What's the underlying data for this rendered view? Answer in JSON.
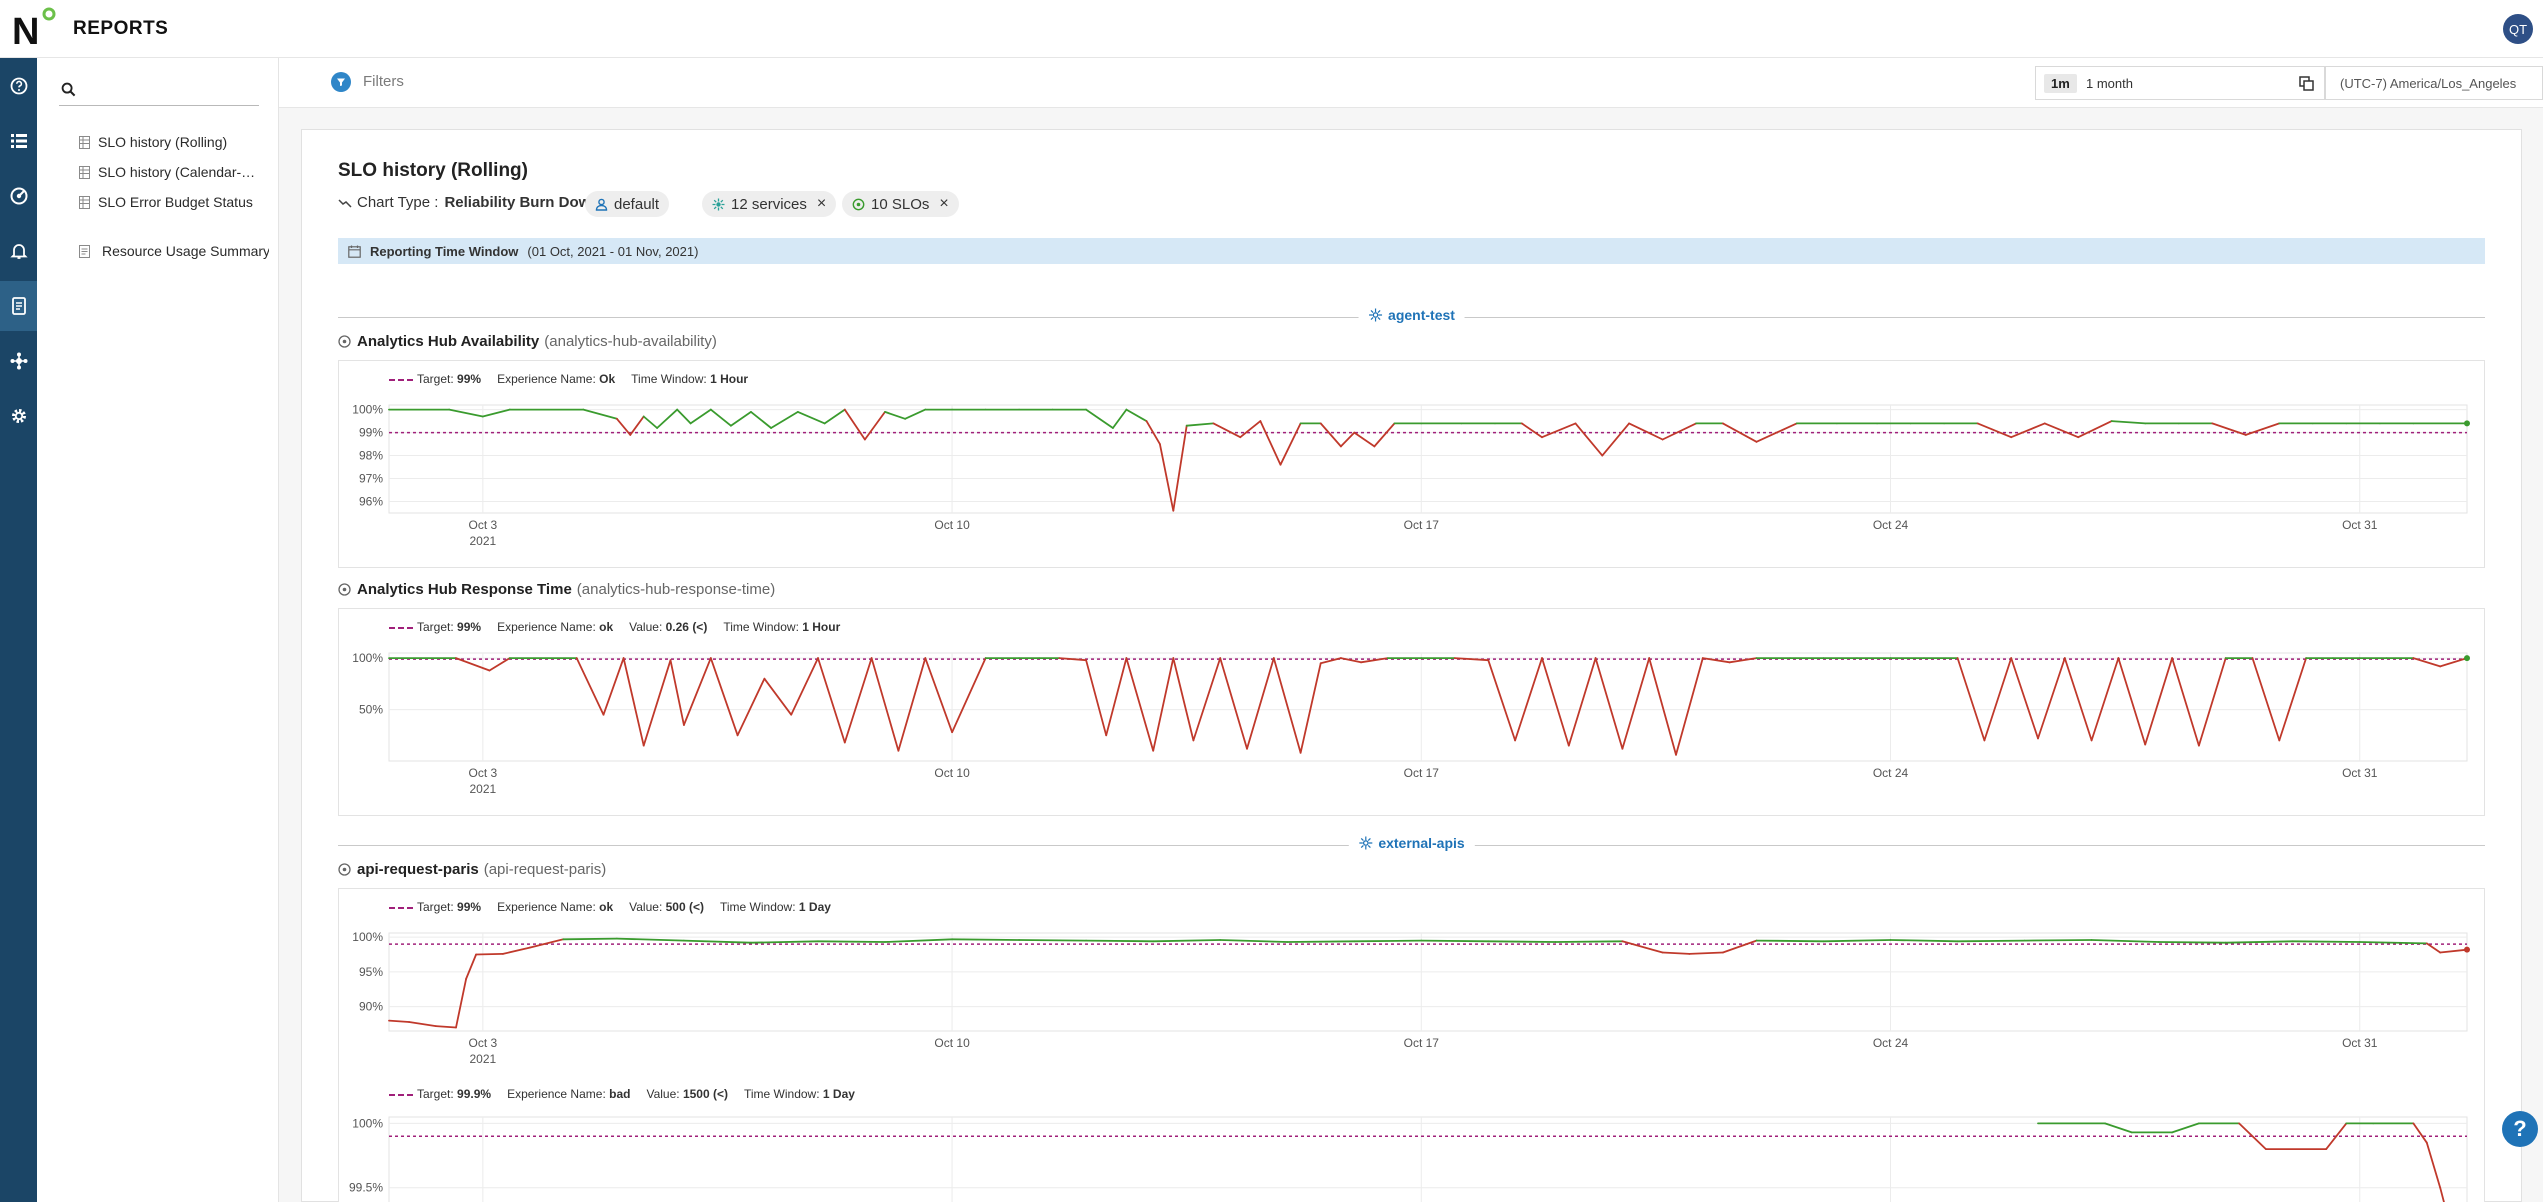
{
  "app": {
    "title": "REPORTS",
    "avatar": "QT",
    "logo_letter": "N"
  },
  "rail": {
    "icons": [
      "help-circle-icon",
      "list-icon",
      "gauge-icon",
      "bell-icon",
      "report-icon",
      "integrations-icon",
      "settings-icon"
    ],
    "active_index": 4
  },
  "sidebar": {
    "items": [
      {
        "label": "SLO history (Rolling)",
        "icon": "table-icon"
      },
      {
        "label": "SLO history (Calendar-Aligned)",
        "icon": "table-icon"
      },
      {
        "label": "SLO Error Budget Status",
        "icon": "table-icon"
      },
      {
        "label": "Resource Usage Summary",
        "icon": "document-icon"
      }
    ]
  },
  "filterbar": {
    "filters_label": "Filters",
    "range_chip": "1m",
    "range_text": "1 month",
    "timezone": "(UTC-7) America/Los_Angeles"
  },
  "report": {
    "title": "SLO history (Rolling)",
    "chart_type_label": "Chart Type :",
    "chart_type_value": "Reliability Burn Down",
    "pills": {
      "project": "default",
      "services": "12 services",
      "slos": "10 SLOs"
    },
    "window_label": "Reporting Time Window",
    "window_range": "(01 Oct, 2021 - 01 Nov, 2021)"
  },
  "sections": [
    {
      "service": "agent-test"
    },
    {
      "service": "external-apis"
    }
  ],
  "slos": [
    {
      "name": "Analytics Hub Availability",
      "slug": "(analytics-hub-availability)"
    },
    {
      "name": "Analytics Hub Response Time",
      "slug": "(analytics-hub-response-time)"
    },
    {
      "name": "api-request-paris",
      "slug": "(api-request-paris)"
    }
  ],
  "legend_labels": {
    "target": "Target:",
    "experience": "Experience Name:",
    "value": "Value:",
    "window": "Time Window:"
  },
  "colors": {
    "good": "#3a9b2e",
    "bad": "#c0392b",
    "target": "#a0207a",
    "accent": "#1f73b7",
    "rail": "#1b4566"
  },
  "chart_data": [
    {
      "type": "line",
      "slo": "Analytics Hub Availability",
      "target": "99%",
      "target_value": 99,
      "experience": "Ok",
      "value": "",
      "time_window": "1 Hour",
      "ylim": [
        95.5,
        100.2
      ],
      "yticks": [
        {
          "v": 100,
          "label": "100%"
        },
        {
          "v": 99,
          "label": "99%"
        },
        {
          "v": 98,
          "label": "98%"
        },
        {
          "v": 97,
          "label": "97%"
        },
        {
          "v": 96,
          "label": "96%"
        }
      ],
      "xticks": [
        {
          "day": 3,
          "label": "Oct 3",
          "sub": "2021"
        },
        {
          "day": 10,
          "label": "Oct 10",
          "sub": ""
        },
        {
          "day": 17,
          "label": "Oct 17",
          "sub": ""
        },
        {
          "day": 24,
          "label": "Oct 24",
          "sub": ""
        },
        {
          "day": 31,
          "label": "Oct 31",
          "sub": ""
        }
      ],
      "xlim": [
        1.6,
        32.6
      ],
      "x": [
        1.6,
        2.5,
        3.0,
        3.4,
        4.5,
        5.0,
        5.2,
        5.4,
        5.6,
        5.9,
        6.1,
        6.4,
        6.7,
        7.0,
        7.3,
        7.7,
        8.1,
        8.4,
        8.7,
        9.0,
        9.3,
        9.6,
        10.0,
        10.5,
        11.0,
        11.5,
        12.0,
        12.4,
        12.6,
        12.9,
        13.1,
        13.3,
        13.5,
        13.9,
        14.3,
        14.6,
        14.9,
        15.2,
        15.5,
        15.8,
        16.0,
        16.3,
        16.6,
        17.0,
        17.6,
        18.1,
        18.5,
        18.8,
        19.3,
        19.7,
        20.1,
        20.6,
        21.1,
        21.5,
        22.0,
        22.6,
        23.2,
        23.8,
        24.3,
        24.8,
        25.3,
        25.8,
        26.3,
        26.8,
        27.3,
        27.8,
        28.3,
        28.8,
        29.3,
        29.8,
        30.3,
        30.8,
        31.3,
        31.8,
        32.6
      ],
      "y": [
        100,
        100,
        99.7,
        100,
        100,
        99.6,
        98.9,
        99.7,
        99.2,
        100,
        99.4,
        100,
        99.3,
        99.9,
        99.2,
        99.9,
        99.4,
        100,
        98.7,
        99.9,
        99.6,
        100,
        100,
        100,
        100,
        100,
        100,
        99.2,
        100,
        99.5,
        98.5,
        95.6,
        99.3,
        99.4,
        98.8,
        99.5,
        97.6,
        99.4,
        99.4,
        98.4,
        99.0,
        98.4,
        99.4,
        99.4,
        99.4,
        99.4,
        99.4,
        98.8,
        99.4,
        98.0,
        99.4,
        98.7,
        99.4,
        99.4,
        98.6,
        99.4,
        99.4,
        99.4,
        99.4,
        99.4,
        99.4,
        98.8,
        99.4,
        98.8,
        99.5,
        99.4,
        99.4,
        99.4,
        98.9,
        99.4,
        99.4,
        99.4,
        99.4,
        99.4,
        99.4
      ]
    },
    {
      "type": "line",
      "slo": "Analytics Hub Response Time",
      "target": "99%",
      "target_value": 99,
      "experience": "ok",
      "value": "0.26 (<)",
      "time_window": "1 Hour",
      "ylim": [
        0,
        105
      ],
      "yticks": [
        {
          "v": 100,
          "label": "100%"
        },
        {
          "v": 50,
          "label": "50%"
        }
      ],
      "xticks": [
        {
          "day": 3,
          "label": "Oct 3",
          "sub": "2021"
        },
        {
          "day": 10,
          "label": "Oct 10",
          "sub": ""
        },
        {
          "day": 17,
          "label": "Oct 17",
          "sub": ""
        },
        {
          "day": 24,
          "label": "Oct 24",
          "sub": ""
        },
        {
          "day": 31,
          "label": "Oct 31",
          "sub": ""
        }
      ],
      "xlim": [
        1.6,
        32.6
      ],
      "x": [
        1.6,
        2.6,
        3.1,
        3.4,
        4.4,
        4.8,
        5.1,
        5.4,
        5.8,
        6.0,
        6.4,
        6.8,
        7.2,
        7.6,
        8.0,
        8.4,
        8.8,
        9.2,
        9.6,
        10.0,
        10.5,
        11.0,
        11.3,
        11.6,
        12.0,
        12.3,
        12.6,
        13.0,
        13.3,
        13.6,
        14.0,
        14.4,
        14.8,
        15.2,
        15.5,
        15.8,
        16.1,
        16.5,
        17.0,
        17.5,
        18.0,
        18.4,
        18.8,
        19.2,
        19.6,
        20.0,
        20.4,
        20.8,
        21.2,
        21.6,
        22.0,
        22.5,
        23.0,
        23.5,
        24.0,
        24.5,
        25.0,
        25.4,
        25.8,
        26.2,
        26.6,
        27.0,
        27.4,
        27.8,
        28.2,
        28.6,
        29.0,
        29.4,
        29.8,
        30.2,
        30.6,
        31.0,
        31.4,
        31.8,
        32.2,
        32.6
      ],
      "y": [
        100,
        100,
        88,
        100,
        100,
        45,
        100,
        15,
        98,
        35,
        100,
        25,
        80,
        45,
        100,
        18,
        100,
        10,
        100,
        28,
        100,
        100,
        100,
        100,
        98,
        25,
        100,
        10,
        100,
        20,
        100,
        12,
        100,
        8,
        95,
        100,
        96,
        100,
        100,
        100,
        98,
        20,
        100,
        15,
        100,
        12,
        100,
        6,
        100,
        96,
        100,
        100,
        100,
        100,
        100,
        100,
        100,
        20,
        100,
        22,
        100,
        20,
        100,
        16,
        100,
        15,
        100,
        100,
        20,
        100,
        100,
        100,
        100,
        100,
        92,
        100
      ]
    },
    {
      "type": "line",
      "slo": "api-request-paris",
      "target": "99%",
      "target_value": 99,
      "experience": "ok",
      "value": "500 (<)",
      "time_window": "1 Day",
      "ylim": [
        86.5,
        100.6
      ],
      "yticks": [
        {
          "v": 100,
          "label": "100%"
        },
        {
          "v": 95,
          "label": "95%"
        },
        {
          "v": 90,
          "label": "90%"
        }
      ],
      "xticks": [
        {
          "day": 3,
          "label": "Oct 3",
          "sub": "2021"
        },
        {
          "day": 10,
          "label": "Oct 10",
          "sub": ""
        },
        {
          "day": 17,
          "label": "Oct 17",
          "sub": ""
        },
        {
          "day": 24,
          "label": "Oct 24",
          "sub": ""
        },
        {
          "day": 31,
          "label": "Oct 31",
          "sub": ""
        }
      ],
      "xlim": [
        1.6,
        32.6
      ],
      "x": [
        1.6,
        1.9,
        2.3,
        2.6,
        2.75,
        2.9,
        3.3,
        3.7,
        4.2,
        5.0,
        6.0,
        7.0,
        8.0,
        9.0,
        10.0,
        11.0,
        12.0,
        13.0,
        14.0,
        15.0,
        16.0,
        17.0,
        18.0,
        19.0,
        20.0,
        20.6,
        21.0,
        21.5,
        22.0,
        23.0,
        24.0,
        25.0,
        26.0,
        27.0,
        28.0,
        29.0,
        30.0,
        31.0,
        32.0,
        32.2,
        32.6
      ],
      "y": [
        88,
        87.8,
        87.2,
        87.0,
        94,
        97.5,
        97.6,
        98.5,
        99.7,
        99.8,
        99.5,
        99.2,
        99.4,
        99.3,
        99.7,
        99.6,
        99.5,
        99.4,
        99.6,
        99.3,
        99.4,
        99.5,
        99.4,
        99.3,
        99.4,
        97.8,
        97.6,
        97.8,
        99.5,
        99.4,
        99.6,
        99.4,
        99.5,
        99.6,
        99.3,
        99.2,
        99.4,
        99.3,
        99.1,
        97.8,
        98.2
      ]
    },
    {
      "type": "line",
      "slo": "api-request-paris",
      "target": "99.9%",
      "target_value": 99.9,
      "experience": "bad",
      "value": "1500 (<)",
      "time_window": "1 Day",
      "ylim": [
        99.35,
        100.05
      ],
      "yticks": [
        {
          "v": 100,
          "label": "100%"
        },
        {
          "v": 99.5,
          "label": "99.5%"
        }
      ],
      "xticks": [
        {
          "day": 3,
          "label": "",
          "sub": ""
        },
        {
          "day": 10,
          "label": "",
          "sub": ""
        },
        {
          "day": 17,
          "label": "",
          "sub": ""
        },
        {
          "day": 24,
          "label": "",
          "sub": ""
        },
        {
          "day": 31,
          "label": "",
          "sub": ""
        }
      ],
      "xlim": [
        1.6,
        32.6
      ],
      "x": [
        26.2,
        27.2,
        27.6,
        28.2,
        28.6,
        29.2,
        29.6,
        30.5,
        30.8,
        31.2,
        31.8,
        32.0,
        32.2,
        32.3
      ],
      "y": [
        100,
        100,
        99.93,
        99.93,
        100,
        100,
        99.8,
        99.8,
        100,
        100,
        100,
        99.85,
        99.5,
        99.3
      ]
    }
  ]
}
